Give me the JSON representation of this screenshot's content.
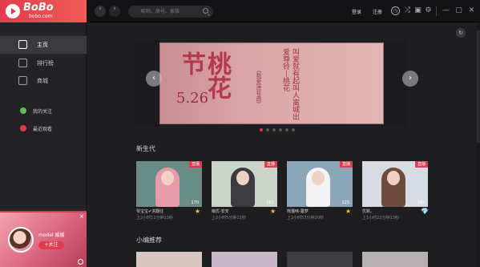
{
  "app": {
    "brand_name": "BoBo",
    "brand_domain": "bobo.com"
  },
  "topbar": {
    "search_placeholder": "昵称、房号、家族",
    "login": "登录",
    "register": "注册",
    "icons": [
      "back-icon",
      "forward-icon",
      "search-icon",
      "history-icon",
      "shuffle-icon",
      "skin-icon",
      "settings-icon",
      "minimize-icon",
      "maximize-icon",
      "close-icon"
    ],
    "back_glyph": "‹",
    "forward_glyph": "›",
    "history_glyph": "◷",
    "shuffle_glyph": "⤮",
    "skin_glyph": "▣",
    "settings_glyph": "⚙",
    "min_glyph": "—",
    "max_glyph": "▢",
    "close_glyph": "✕"
  },
  "sidebar": {
    "items": [
      {
        "label": "主页",
        "icon": "home-icon",
        "active": true
      },
      {
        "label": "排行榜",
        "icon": "ranking-icon",
        "active": false
      },
      {
        "label": "商城",
        "icon": "shop-icon",
        "active": false
      }
    ],
    "subitems": [
      {
        "label": "我的关注",
        "icon": "follow-icon",
        "color": "#5bbf4a"
      },
      {
        "label": "最近观看",
        "icon": "recent-icon",
        "color": "#e23b4d"
      }
    ]
  },
  "profile": {
    "name": "model  媛媛",
    "follow_label": "+关注",
    "close_glyph": "×"
  },
  "banner": {
    "title": "桃花节",
    "date": "5.26",
    "poem": "叫爱就有起叫人离城出爱尊铃丨桃花",
    "sub": "《我爱莲花曲》",
    "prev_glyph": "‹",
    "next_glyph": "›",
    "dot_count": 6,
    "active_dot": 0
  },
  "sections": {
    "new_gen": "新生代",
    "editor_picks": "小编推荐"
  },
  "cards": [
    {
      "name": "琴宝宝✔求翻往",
      "meta": "上2小时11分钟13秒",
      "views": "170",
      "live": "直播",
      "badge": "★",
      "bg": "#6a8c86",
      "cloth": "#e79aa9"
    },
    {
      "name": "萌优-安安",
      "meta": "上2小时5分钟11秒",
      "views": "161",
      "live": "直播",
      "badge": "★",
      "bg": "#cbd4c9",
      "cloth": "#3b3b40"
    },
    {
      "name": "熊猫咪-露梦",
      "meta": "上2小时53分钟20秒",
      "views": "125",
      "live": "直播",
      "badge": "★",
      "bg": "#8aa6b8",
      "cloth": "#f3f3f3"
    },
    {
      "name": "优默。",
      "meta": "上1小时22分钟13秒",
      "views": "145",
      "live": "直播",
      "badge": "💎",
      "bg": "#d7dbe4",
      "cloth": "#6f4b3c"
    }
  ],
  "colors": {
    "accent": "#e23b4d",
    "bg": "#1e1e21",
    "sidebar": "#232327"
  }
}
